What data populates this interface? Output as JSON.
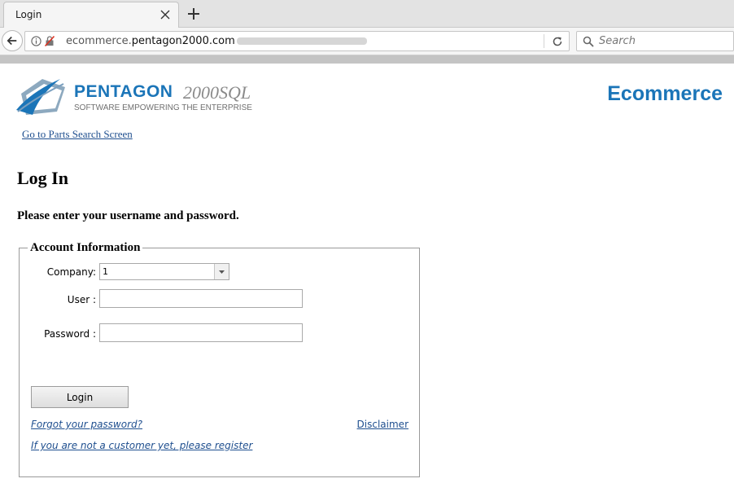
{
  "browser": {
    "tab_title": "Login",
    "url_prefix": "ecommerce.",
    "url_domain": "pentagon2000.com",
    "search_placeholder": "Search"
  },
  "header": {
    "brand_name": "PENTAGON",
    "brand_sql": "2000SQL",
    "brand_tagline": "SOFTWARE EMPOWERING THE ENTERPRISE",
    "section_title": "Ecommerce",
    "parts_search_link": "Go to Parts Search Screen"
  },
  "main": {
    "heading": "Log In",
    "instructions": "Please enter your username and password."
  },
  "form": {
    "legend": "Account Information",
    "company_label": "Company:",
    "company_value": "1",
    "user_label": "User :",
    "user_value": "",
    "password_label": "Password :",
    "password_value": "",
    "login_button": "Login",
    "forgot_password_link": "Forgot your password?",
    "disclaimer_link": "Disclaimer",
    "register_link": "If you are not a customer yet, please register"
  },
  "colors": {
    "brand_blue": "#1b75b8",
    "link_blue": "#1f4f8f"
  }
}
